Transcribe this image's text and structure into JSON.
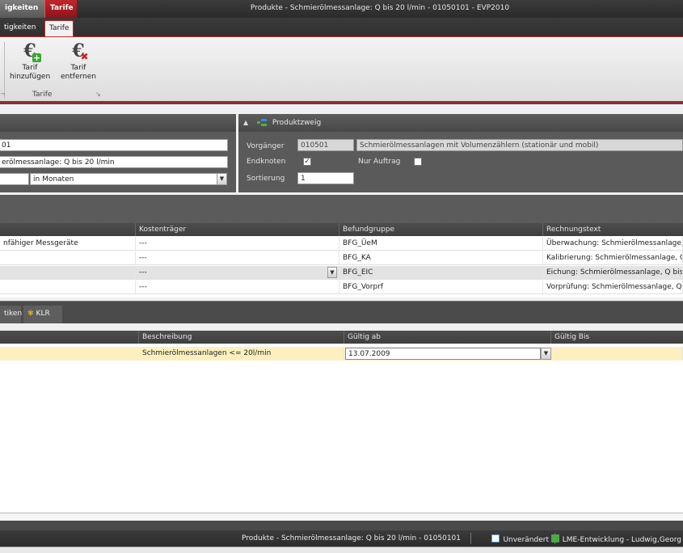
{
  "window": {
    "context_tab_1": "igkeiten",
    "context_tab_2": "Tarife",
    "title": "Produkte - Schmierölmessanlage: Q bis 20 l/min - 01050101 - EVP2010"
  },
  "ribbon": {
    "tabs": [
      "tigkeiten",
      "Tarife"
    ],
    "group_label": "Tarife",
    "add_button": [
      "Tarif",
      "hinzufügen"
    ],
    "remove_button": [
      "Tarif",
      "entfernen"
    ],
    "launcher_icon": "dialog-launcher-icon"
  },
  "left_panel": {
    "code_value": "01",
    "name_value": "erölmessanlage: Q bis 20 l/min",
    "unit_value": "in Monaten"
  },
  "product_branch": {
    "header": "Produktzweig",
    "predecessor_label": "Vorgänger",
    "predecessor_code": "010501",
    "predecessor_text": "Schmierölmessanlagen mit Volumenzählern (stationär und mobil)",
    "endnode_label": "Endknoten",
    "endnode_checked": true,
    "only_order_label": "Nur Auftrag",
    "only_order_checked": false,
    "sort_label": "Sortierung",
    "sort_value": "1"
  },
  "findings_grid": {
    "columns": [
      "Kostenträger",
      "Befundgruppe",
      "Rechnungstext"
    ],
    "rows": [
      {
        "c0": "nfähiger Messgeräte",
        "cost": "---",
        "group": "BFG_ÜeM",
        "text": "Überwachung: Schmierölmessanlage,"
      },
      {
        "c0": "",
        "cost": "---",
        "group": "BFG_KA",
        "text": "Kalibrierung: Schmierölmessanlage, Q"
      },
      {
        "c0": "",
        "cost": "---",
        "group": "BFG_EIC",
        "text": "Eichung: Schmierölmessanlage, Q bis"
      },
      {
        "c0": "",
        "cost": "---",
        "group": "BFG_Vorprf",
        "text": "Vorprüfung: Schmierölmessanlage, Q"
      }
    ]
  },
  "bottom_tabs": [
    "tiken",
    "KLR"
  ],
  "tariff_grid": {
    "columns": [
      "Beschreibung",
      "Gültig ab",
      "Gültig Bis"
    ],
    "rows": [
      {
        "desc": "Schmierölmessanlagen <= 20l/min",
        "valid_from": "13.07.2009",
        "valid_to": ""
      }
    ]
  },
  "statusbar": {
    "title": "Produkte - Schmierölmessanlage: Q bis 20 l/min - 01050101",
    "state": "Unverändert",
    "user": "LME-Entwicklung - Ludwig,Georg"
  }
}
